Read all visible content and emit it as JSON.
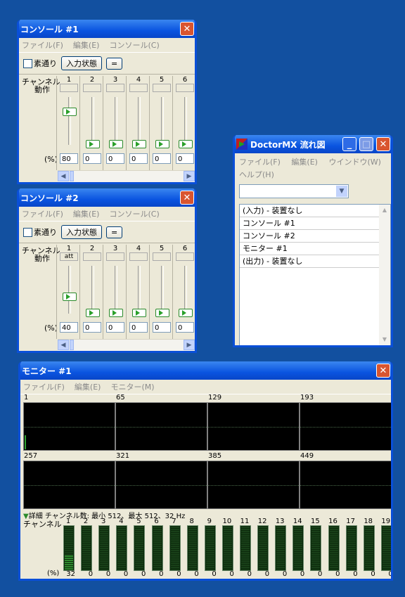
{
  "console1": {
    "title": "コンソール #1",
    "menu": [
      "ファイル(F)",
      "編集(E)",
      "コンソール(C)"
    ],
    "passthrough_label": "素通り",
    "input_state_button": "入力状態",
    "equals_button": "=",
    "channel_label": "チャンネル",
    "action_label": "動作",
    "percent_label": "(%)",
    "channels": [
      {
        "num": "1",
        "action": "",
        "value": "80",
        "level": 0.8
      },
      {
        "num": "2",
        "action": "",
        "value": "0",
        "level": 0
      },
      {
        "num": "3",
        "action": "",
        "value": "0",
        "level": 0
      },
      {
        "num": "4",
        "action": "",
        "value": "0",
        "level": 0
      },
      {
        "num": "5",
        "action": "",
        "value": "0",
        "level": 0
      },
      {
        "num": "6",
        "action": "",
        "value": "0",
        "level": 0
      }
    ]
  },
  "console2": {
    "title": "コンソール #2",
    "menu": [
      "ファイル(F)",
      "編集(E)",
      "コンソール(C)"
    ],
    "passthrough_label": "素通り",
    "input_state_button": "入力状態",
    "equals_button": "=",
    "channel_label": "チャンネル",
    "action_label": "動作",
    "percent_label": "(%)",
    "channels": [
      {
        "num": "1",
        "action": "att",
        "value": "40",
        "level": 0.4
      },
      {
        "num": "2",
        "action": "",
        "value": "0",
        "level": 0
      },
      {
        "num": "3",
        "action": "",
        "value": "0",
        "level": 0
      },
      {
        "num": "4",
        "action": "",
        "value": "0",
        "level": 0
      },
      {
        "num": "5",
        "action": "",
        "value": "0",
        "level": 0
      },
      {
        "num": "6",
        "action": "",
        "value": "0",
        "level": 0
      }
    ]
  },
  "flow": {
    "title": "DoctorMX 流れ図",
    "menu": [
      "ファイル(F)",
      "編集(E)",
      "ウインドウ(W)",
      "ヘルプ(H)"
    ],
    "combo_value": "",
    "items": [
      "(入力) - 装置なし",
      "コンソール #1",
      "コンソール #2",
      "モニター #1",
      "(出力) - 装置なし"
    ]
  },
  "monitor": {
    "title": "モニター #1",
    "menu": [
      "ファイル(F)",
      "編集(E)",
      "モニター(M)"
    ],
    "panels": [
      "1",
      "65",
      "129",
      "193",
      "257",
      "321",
      "385",
      "449"
    ],
    "details_label": "詳細",
    "details_text": "チャンネル数: 最小 512、最大 512、32 Hz",
    "channel_label": "チャンネル",
    "percent_label": "(%)",
    "channels": [
      {
        "num": "1",
        "value": "32",
        "level": 0.32
      },
      {
        "num": "2",
        "value": "0",
        "level": 0
      },
      {
        "num": "3",
        "value": "0",
        "level": 0
      },
      {
        "num": "4",
        "value": "0",
        "level": 0
      },
      {
        "num": "5",
        "value": "0",
        "level": 0
      },
      {
        "num": "6",
        "value": "0",
        "level": 0
      },
      {
        "num": "7",
        "value": "0",
        "level": 0
      },
      {
        "num": "8",
        "value": "0",
        "level": 0
      },
      {
        "num": "9",
        "value": "0",
        "level": 0
      },
      {
        "num": "10",
        "value": "0",
        "level": 0
      },
      {
        "num": "11",
        "value": "0",
        "level": 0
      },
      {
        "num": "12",
        "value": "0",
        "level": 0
      },
      {
        "num": "13",
        "value": "0",
        "level": 0
      },
      {
        "num": "14",
        "value": "0",
        "level": 0
      },
      {
        "num": "15",
        "value": "0",
        "level": 0
      },
      {
        "num": "16",
        "value": "0",
        "level": 0
      },
      {
        "num": "17",
        "value": "0",
        "level": 0
      },
      {
        "num": "18",
        "value": "0",
        "level": 0
      },
      {
        "num": "19",
        "value": "0",
        "level": 0
      }
    ]
  },
  "colors": {
    "desktop": "#1250a0",
    "titlebar": "#0a54e0",
    "close": "#d9552f",
    "meter": "#2e8a2e"
  }
}
